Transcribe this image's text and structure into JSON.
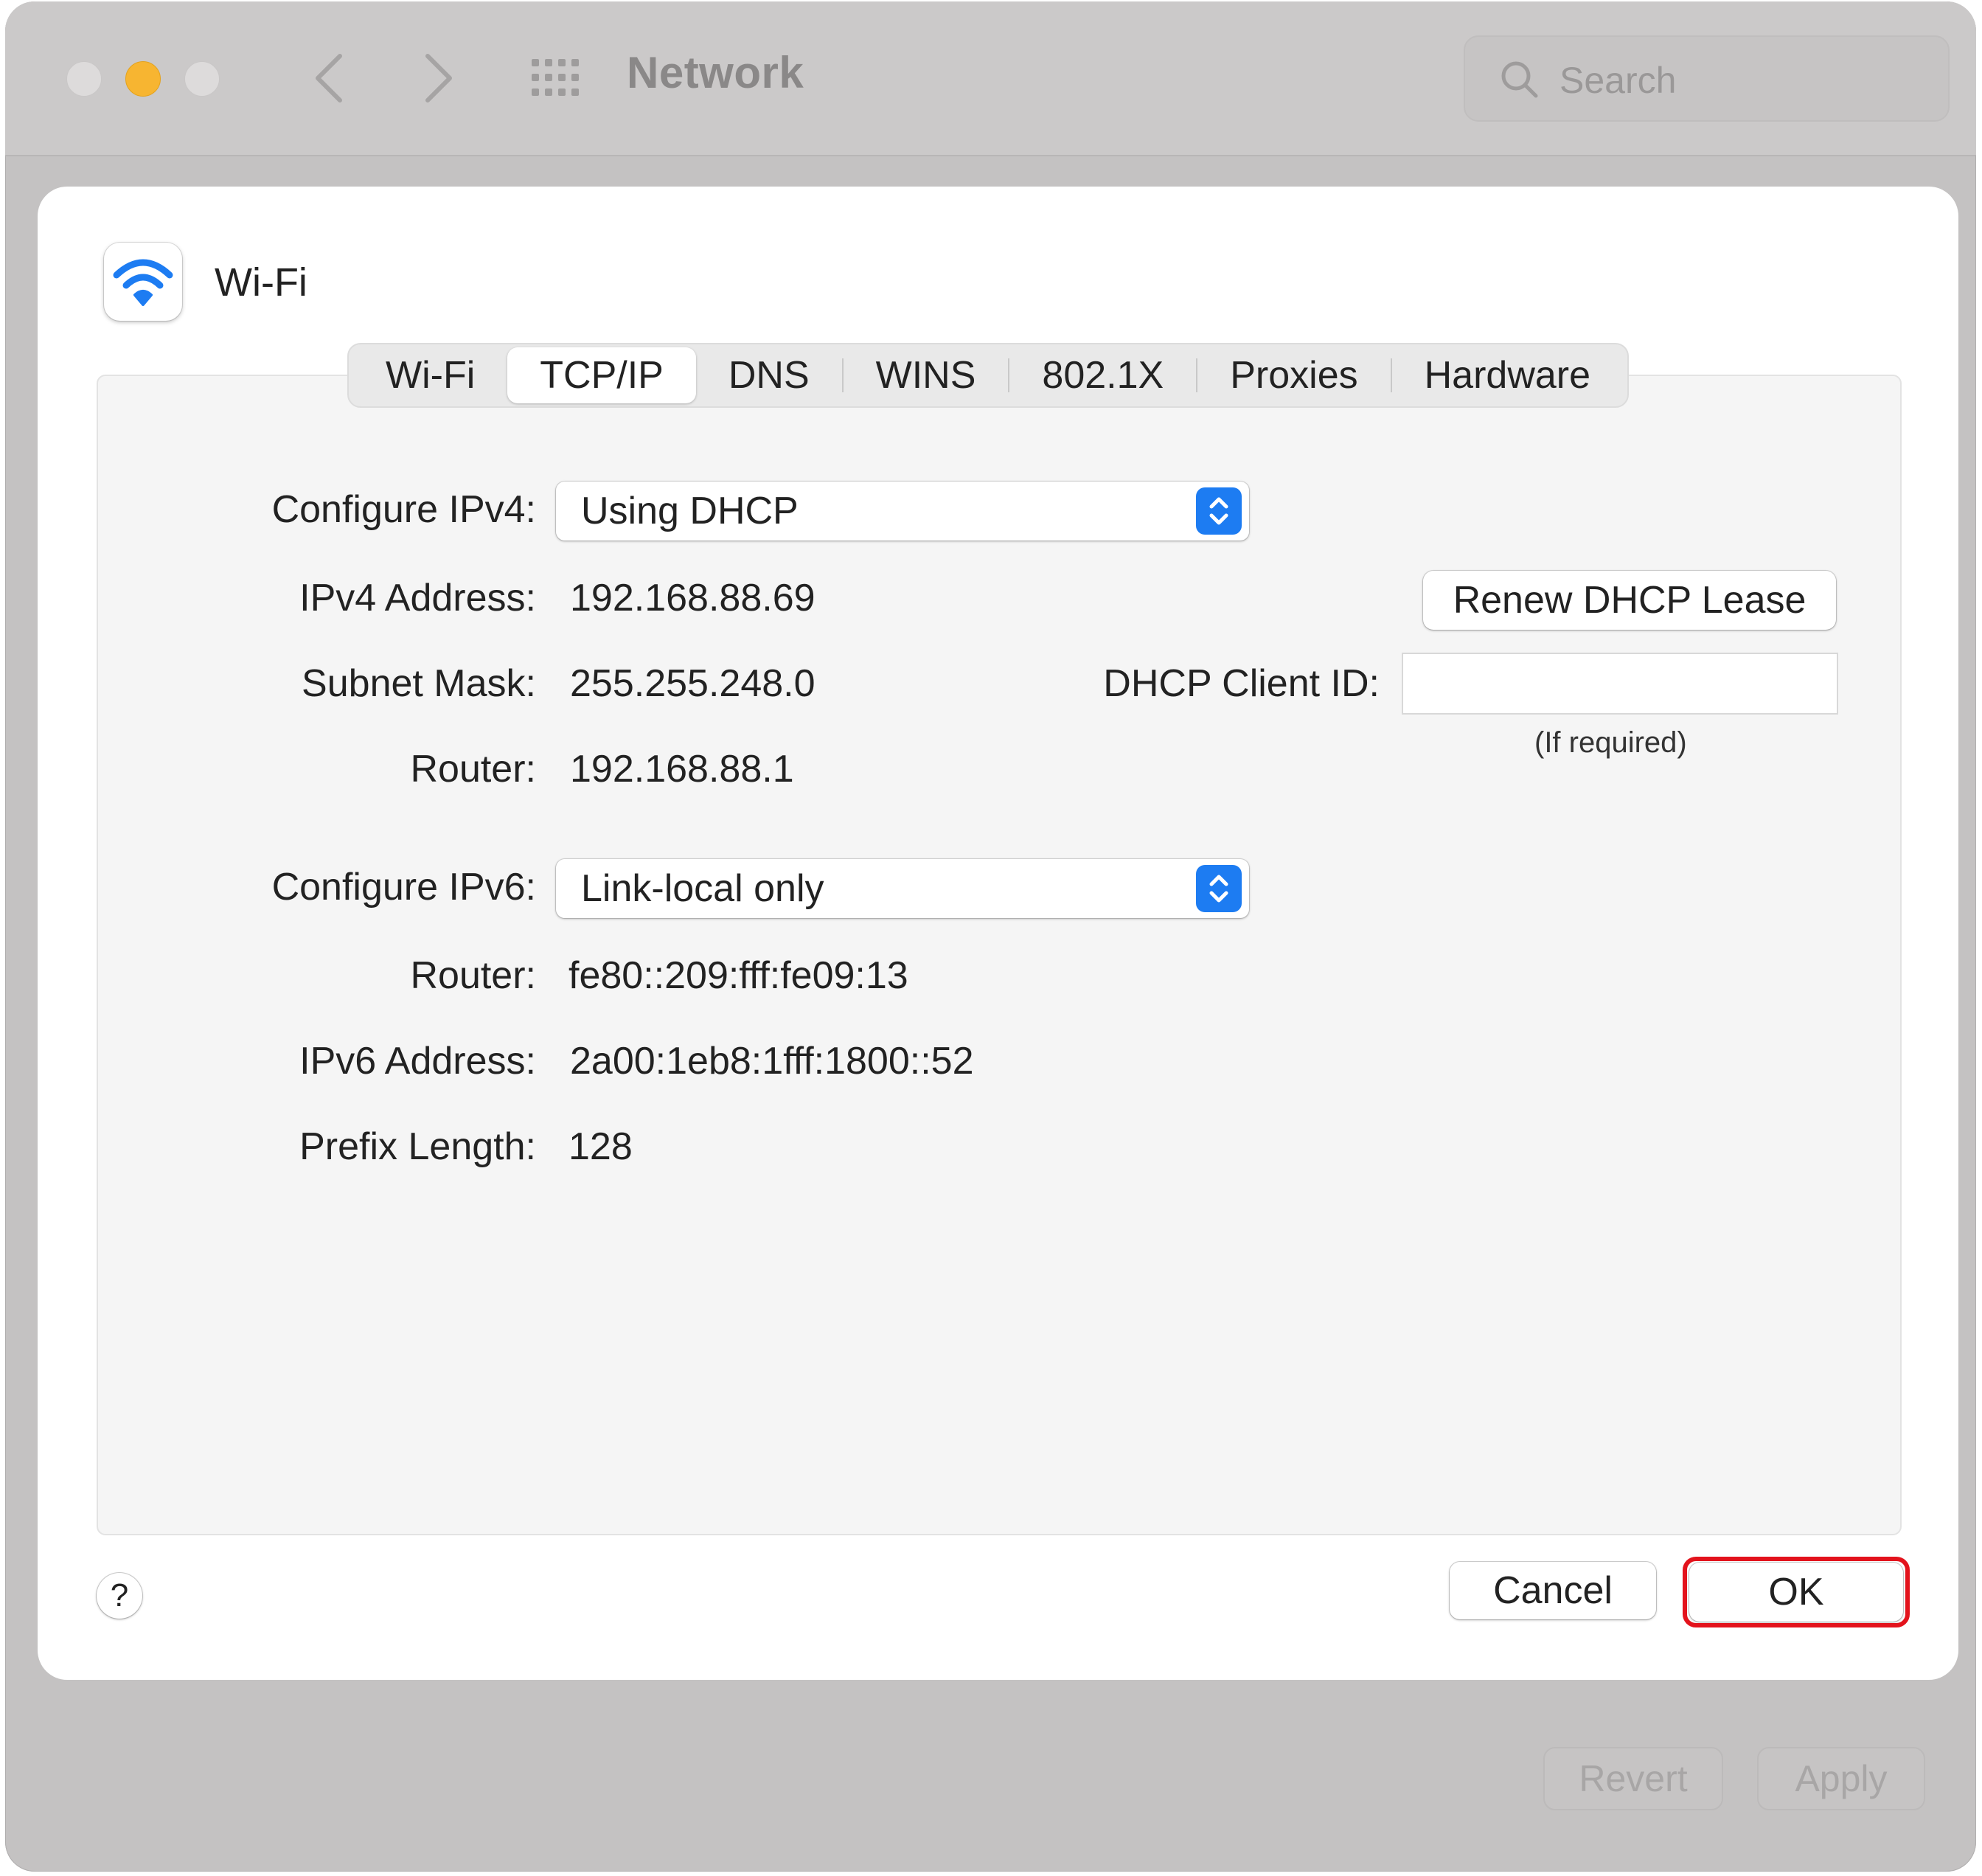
{
  "window": {
    "title": "Network",
    "search_placeholder": "Search",
    "revert_label": "Revert",
    "apply_label": "Apply"
  },
  "sheet": {
    "title": "Wi-Fi",
    "tabs": [
      {
        "label": "Wi-Fi",
        "active": false
      },
      {
        "label": "TCP/IP",
        "active": true
      },
      {
        "label": "DNS",
        "active": false
      },
      {
        "label": "WINS",
        "active": false
      },
      {
        "label": "802.1X",
        "active": false
      },
      {
        "label": "Proxies",
        "active": false
      },
      {
        "label": "Hardware",
        "active": false
      }
    ],
    "ipv4": {
      "configure_label": "Configure IPv4:",
      "configure_value": "Using DHCP",
      "address_label": "IPv4 Address:",
      "address_value": "192.168.88.69",
      "subnet_label": "Subnet Mask:",
      "subnet_value": "255.255.248.0",
      "router_label": "Router:",
      "router_value": "192.168.88.1",
      "renew_button": "Renew DHCP Lease",
      "client_id_label": "DHCP Client ID:",
      "client_id_value": "",
      "client_id_hint": "(If required)"
    },
    "ipv6": {
      "configure_label": "Configure IPv6:",
      "configure_value": "Link-local only",
      "router_label": "Router:",
      "router_value": "fe80::209:fff:fe09:13",
      "address_label": "IPv6 Address:",
      "address_value": "2a00:1eb8:1fff:1800::52",
      "prefix_label": "Prefix Length:",
      "prefix_value": "128"
    },
    "help_label": "?",
    "cancel_label": "Cancel",
    "ok_label": "OK"
  },
  "colors": {
    "accent": "#1d7cf2",
    "highlight": "#e3131c",
    "minimize": "#f7b531"
  }
}
